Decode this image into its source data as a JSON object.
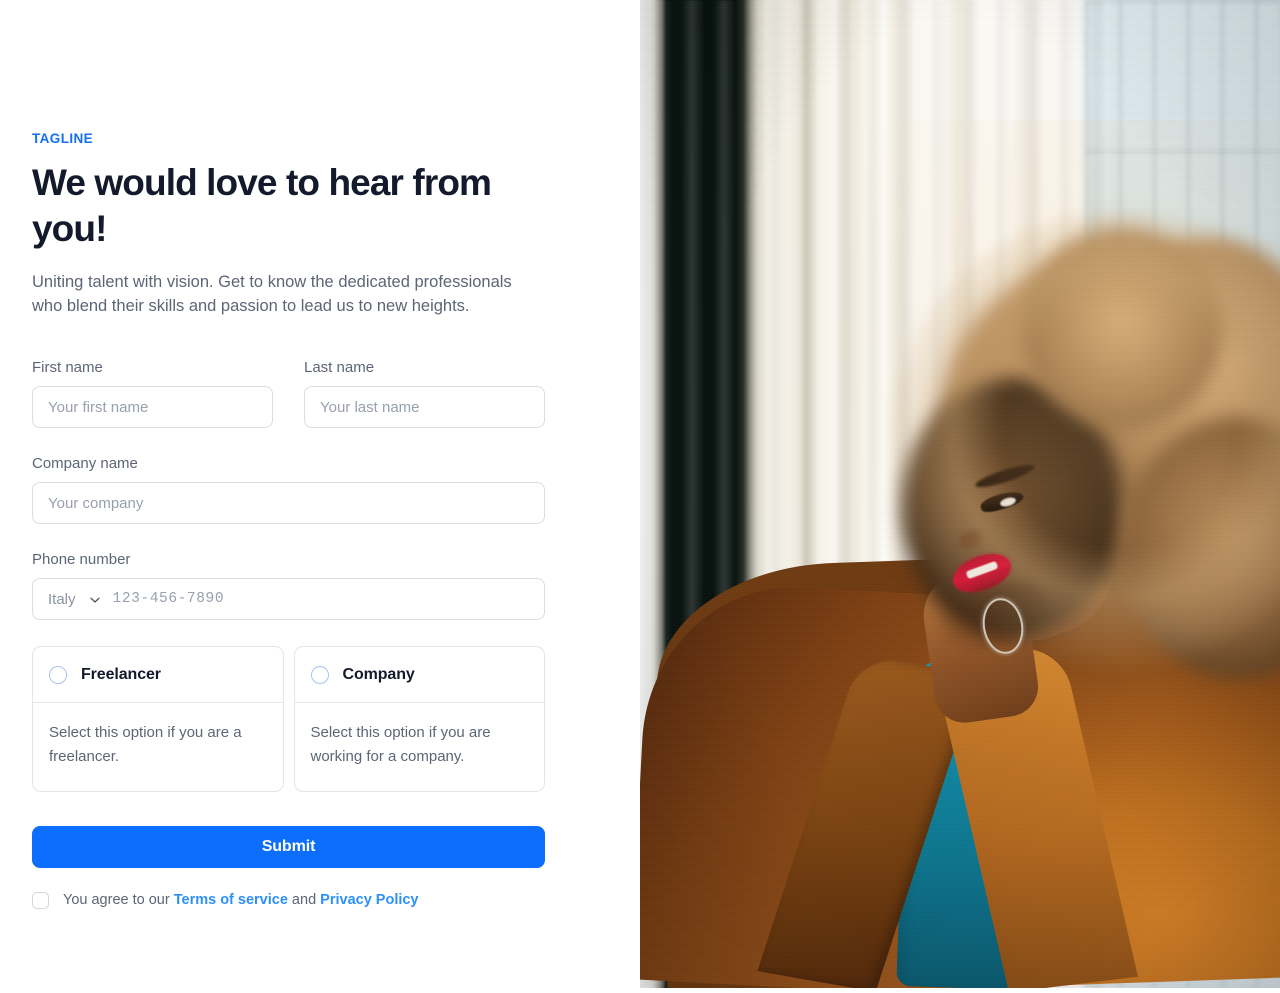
{
  "hero": {
    "tagline": "TAGLINE",
    "headline": "We would love to hear from you!",
    "subhead": "Uniting talent with vision. Get to know the dedicated professionals who blend their skills and passion to lead us to new heights."
  },
  "form": {
    "first_name": {
      "label": "First name",
      "placeholder": "Your first name",
      "value": ""
    },
    "last_name": {
      "label": "Last name",
      "placeholder": "Your last name",
      "value": ""
    },
    "company_name": {
      "label": "Company name",
      "placeholder": "Your company",
      "value": ""
    },
    "phone": {
      "label": "Phone number",
      "country_selected": "Italy",
      "country_options": [
        "Italy"
      ],
      "placeholder": "123-456-7890",
      "value": ""
    },
    "options": [
      {
        "title": "Freelancer",
        "description": "Select this option if you are a freelancer.",
        "selected": false
      },
      {
        "title": "Company",
        "description": "Select this option if you are working for a company.",
        "selected": false
      }
    ],
    "submit_label": "Submit",
    "terms": {
      "checked": false,
      "prefix": "You agree to our ",
      "terms_link": "Terms of service",
      "conjunction": " and ",
      "privacy_link": "Privacy Policy"
    }
  },
  "photo": {
    "alt": "Woman with afro hair in rust blazer and teal turtleneck looking out a window"
  },
  "colors": {
    "accent_blue": "#1570ef",
    "button_blue": "#0d6efd",
    "link_blue": "#2e90fa",
    "heading": "#131a2c",
    "body_text": "#5d6576",
    "border": "#d9dde4",
    "placeholder": "#98a0ae"
  }
}
